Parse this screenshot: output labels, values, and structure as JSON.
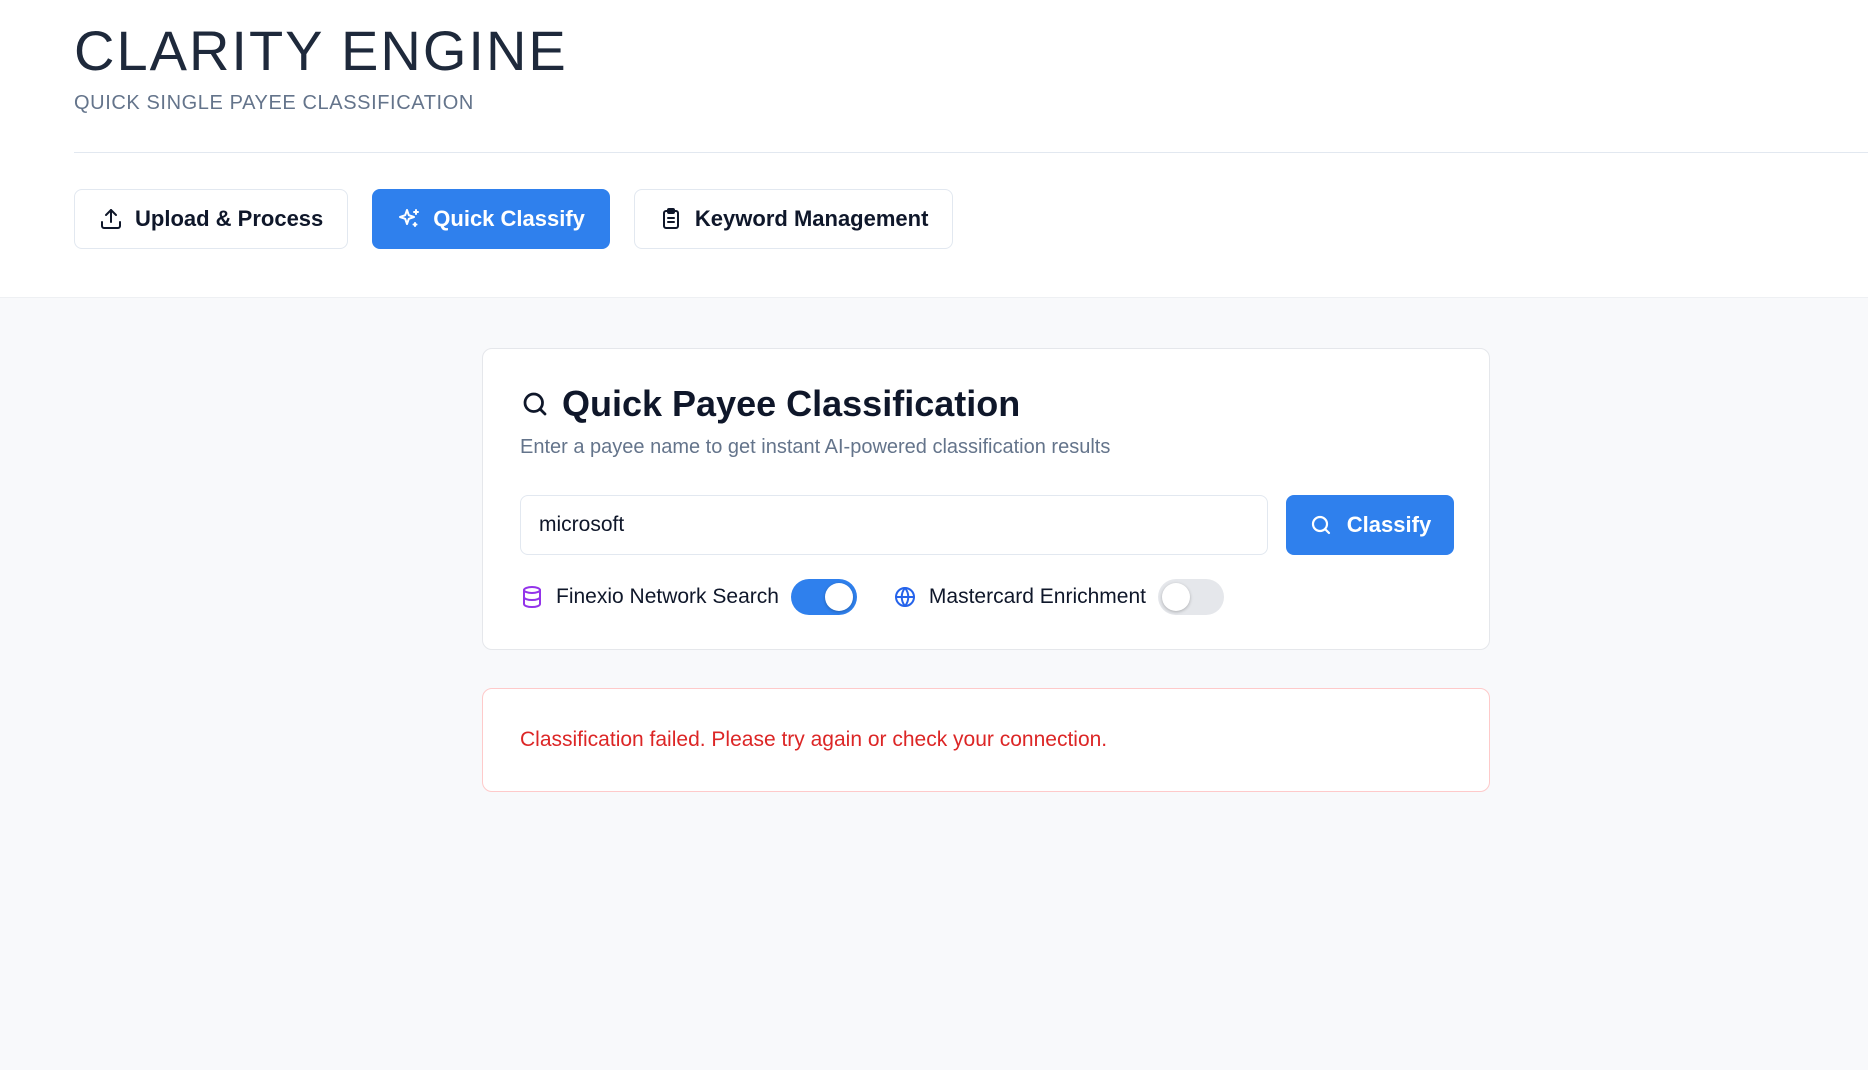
{
  "header": {
    "title": "CLARITY ENGINE",
    "subtitle": "QUICK SINGLE PAYEE CLASSIFICATION"
  },
  "nav": {
    "tabs": [
      {
        "label": "Upload & Process",
        "icon": "upload-icon",
        "active": false
      },
      {
        "label": "Quick Classify",
        "icon": "sparkles-icon",
        "active": true
      },
      {
        "label": "Keyword Management",
        "icon": "clipboard-list-icon",
        "active": false
      }
    ]
  },
  "card": {
    "title": "Quick Payee Classification",
    "title_icon": "search-icon",
    "description": "Enter a payee name to get instant AI-powered classification results",
    "input_value": "microsoft",
    "classify_label": "Classify",
    "toggles": [
      {
        "label": "Finexio Network Search",
        "icon": "database-icon",
        "enabled": true
      },
      {
        "label": "Mastercard Enrichment",
        "icon": "globe-icon",
        "enabled": false
      }
    ]
  },
  "error": {
    "message": "Classification failed. Please try again or check your connection."
  },
  "colors": {
    "accent": "#2f80ed",
    "error": "#dc2626",
    "database_icon": "#9333ea",
    "globe_icon": "#2563eb"
  }
}
